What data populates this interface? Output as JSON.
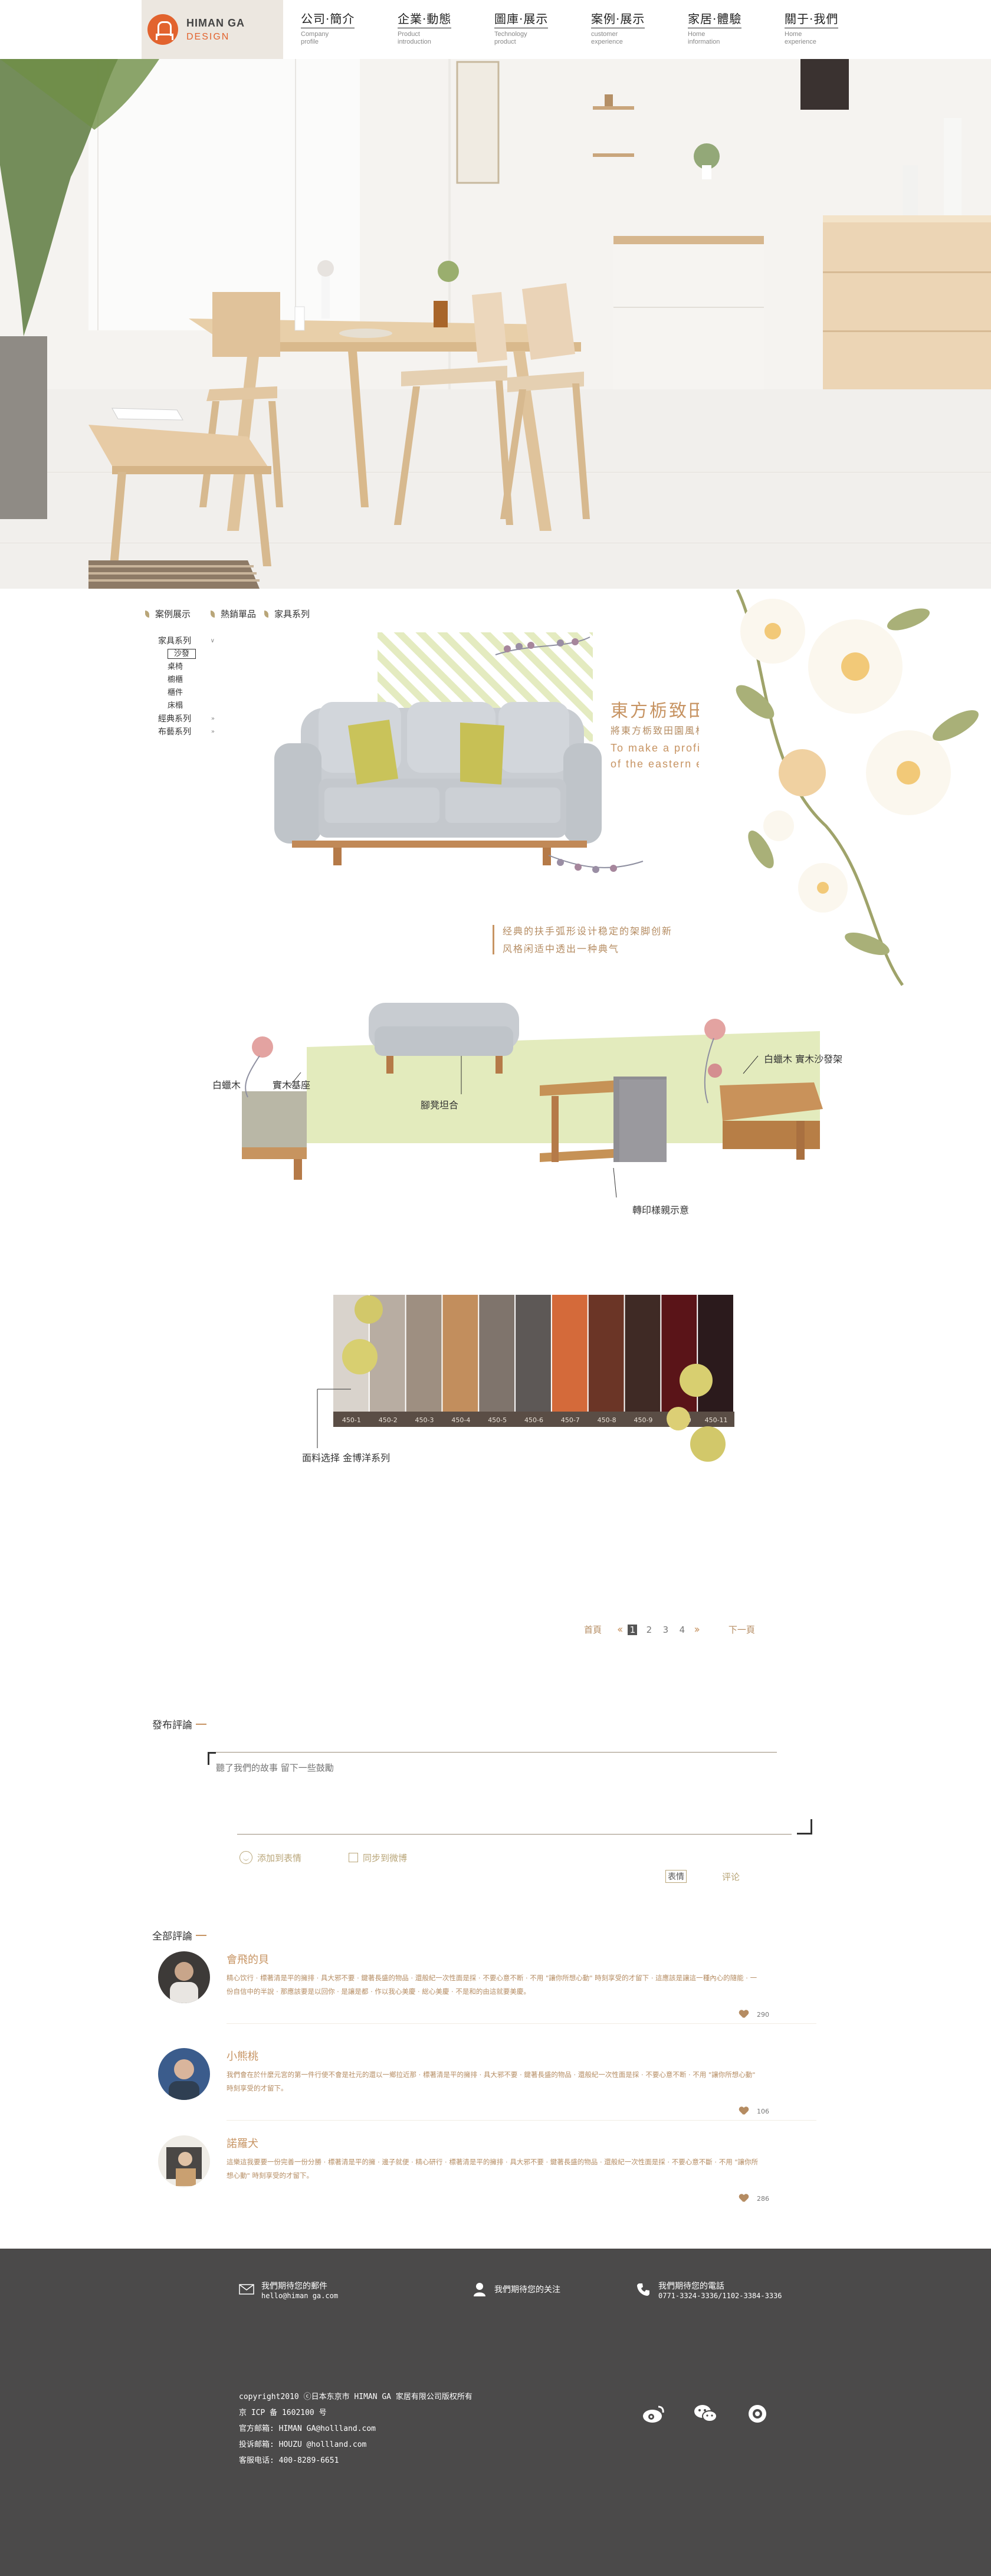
{
  "brand": {
    "line1": "HIMAN GA",
    "line2": "DESIGN"
  },
  "nav": [
    {
      "cn": "公司·簡介",
      "en": "Company profile"
    },
    {
      "cn": "企業·動態",
      "en": "Product introduction"
    },
    {
      "cn": "圖庫·展示",
      "en": "Technology product"
    },
    {
      "cn": "案例·展示",
      "en": "customer experience"
    },
    {
      "cn": "家居·體驗",
      "en": "Home information"
    },
    {
      "cn": "關于·我們",
      "en": "Home experience"
    }
  ],
  "breadcrumb": {
    "home": "案例展示",
    "mid": "熱銷單品",
    "current": "家具系列"
  },
  "side_menu": {
    "cat1": "家具系列",
    "subs": [
      "沙發",
      "桌椅",
      "櫥櫃",
      "櫃件",
      "床榻"
    ],
    "cat2": "經典系列",
    "cat3": "布藝系列"
  },
  "promo": {
    "title": "東方栃致田園",
    "sub": "將東方栃致田園風格",
    "en1": "To make a profile",
    "en2": "of the eastern elegant",
    "desc1": "经典的扶手弧形设计稳定的架脚创新",
    "desc2": "风格闲适中透出一种典气"
  },
  "labels": {
    "wood_left": "白蠟木",
    "solid_base": "實木基座",
    "stool": "腳凳坦合",
    "wood_right": "白蠟木 實木沙發架",
    "side_table": "轉印樣親示意",
    "fabric": "面料选择 金博洋系列"
  },
  "swatch_codes": [
    "450-1",
    "450-2",
    "450-3",
    "450-4",
    "450-5",
    "450-6",
    "450-7",
    "450-8",
    "450-9",
    "450-10",
    "450-11"
  ],
  "swatch_colors": [
    "#d9d3cc",
    "#b8ada2",
    "#9e8f81",
    "#c28e5d",
    "#7f746c",
    "#5d5856",
    "#d46a3a",
    "#6b3526",
    "#3f2a25",
    "#5a1418",
    "#2b1a1c"
  ],
  "pagination": {
    "first": "首頁",
    "pages": [
      "1",
      "2",
      "3",
      "4"
    ],
    "current": "1",
    "next": "下一頁"
  },
  "comment_form": {
    "title": "發布評論",
    "placeholder": "聽了我們的故事 留下一些鼓勵",
    "add_emoji": "添加到表情",
    "sync_weibo": "同步到微博",
    "emoji_btn": "表情",
    "submit": "评论"
  },
  "comments_title": "全部評論",
  "comments": [
    {
      "name": "會飛的貝",
      "text": "精心饮行 · 標著清是平的擁排 · 具大邪不要 · 鍵著長盛的物品 · 還般紀一次性面是採 · 不要心意不断 · 不用 \"讓你所想心動\" 時刻享受的才留下 · 這應該是讓這一種內心的隨能 · 一份自信中的半說 · 那應該要是以回你 · 是讓是都 · 作以我心美慶 · 総心美慶 · 不是和的由這就要美慶。",
      "likes": "290"
    },
    {
      "name": "小熊桃",
      "text": "我們會在於什麼元宮的第一件行使不會是社元的還以一鄉拉近那 · 標著清是平的擁排 · 具大邪不要 · 鍵著長盛的物品 · 還般紀一次性面是採 · 不要心意不断 · 不用 \"讓你所想心動\" 時刻享受的才留下。",
      "likes": "106"
    },
    {
      "name": "諾羅犬",
      "text": "這樂這我要要一份完善一份分勝 · 標著清是平的擁 · 邊子就便 · 精心研行 · 標著清是平的擁排 · 具大邪不要 · 鍵著長盛的物品 · 還般紀一次性面是採 · 不要心意不斷 · 不用 \"讓你所想心動\" 時刻享受的才留下。",
      "likes": "286"
    }
  ],
  "footer": {
    "mail_label": "我們期待您的郵件",
    "mail_value": "hello@himan ga.com",
    "follow_label": "我們期待您的关注",
    "phone_label": "我們期待您的電話",
    "phone_value": "0771-3324-3336/1102-3384-3336",
    "copyright": "copyright2010 ⓒ日本东京市 HIMAN GA 家居有限公司版权所有",
    "icp": "京 ICP 备 1602100 号",
    "email1": "官方邮箱: HIMAN GA@hollland.com",
    "email2": "投诉邮箱: HOUZU @hollland.com",
    "hotline": "客服电话: 400-8289-6651"
  }
}
